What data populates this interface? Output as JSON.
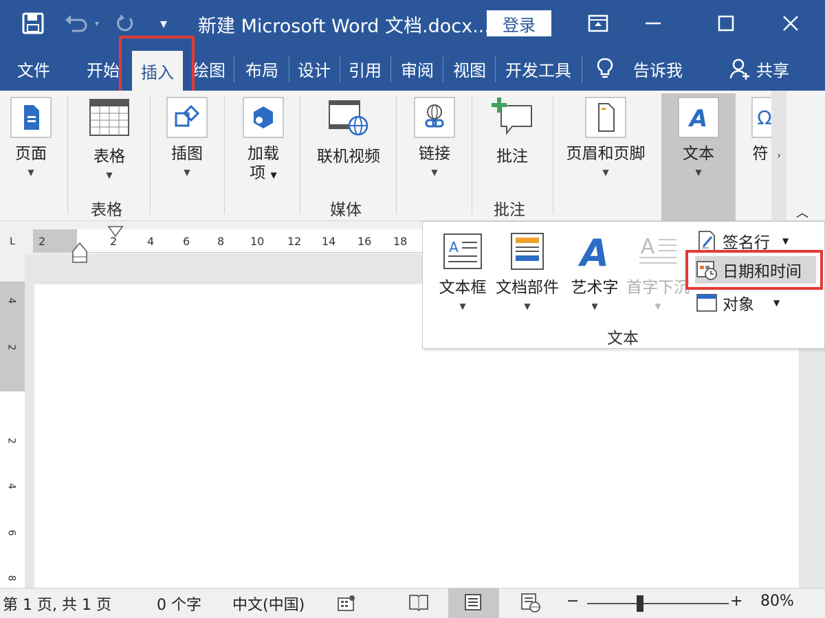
{
  "titlebar": {
    "title": "新建 Microsoft Word 文档.docx...",
    "login": "登录",
    "qat_dropdown": "▾"
  },
  "tabs": [
    "文件",
    "开始",
    "插入",
    "绘图",
    "布局",
    "设计",
    "引用",
    "审阅",
    "视图",
    "开发工具",
    "告诉我",
    "共享"
  ],
  "ribbon": {
    "page": "页面",
    "table": "表格",
    "table_group": "表格",
    "illustrations": "插图",
    "addins_line1": "加载",
    "addins_line2": "项",
    "online_video": "联机视频",
    "media_group": "媒体",
    "link": "链接",
    "comment": "批注",
    "comment_group": "批注",
    "header_footer": "页眉和页脚",
    "text": "文本",
    "symbols": "符"
  },
  "text_panel": {
    "textbox": "文本框",
    "quick_parts": "文档部件",
    "wordart": "艺术字",
    "dropcap": "首字下沉",
    "signature_line": "签名行",
    "date_time": "日期和时间",
    "object": "对象",
    "group_label": "文本"
  },
  "ruler": {
    "corner": "L",
    "h_numbers": [
      "2",
      "2",
      "4",
      "6",
      "8",
      "10",
      "12",
      "14",
      "16",
      "18"
    ],
    "v_numbers": [
      "4",
      "2",
      "2",
      "4",
      "6",
      "8"
    ]
  },
  "statusbar": {
    "page": "第 1 页, 共 1 页",
    "words": "0 个字",
    "language": "中文(中国)",
    "zoom_minus": "−",
    "zoom_plus": "+",
    "zoom": "80%"
  },
  "colors": {
    "accent": "#2b579a",
    "highlight": "#e53935",
    "active_bg": "#c6c6c6"
  }
}
